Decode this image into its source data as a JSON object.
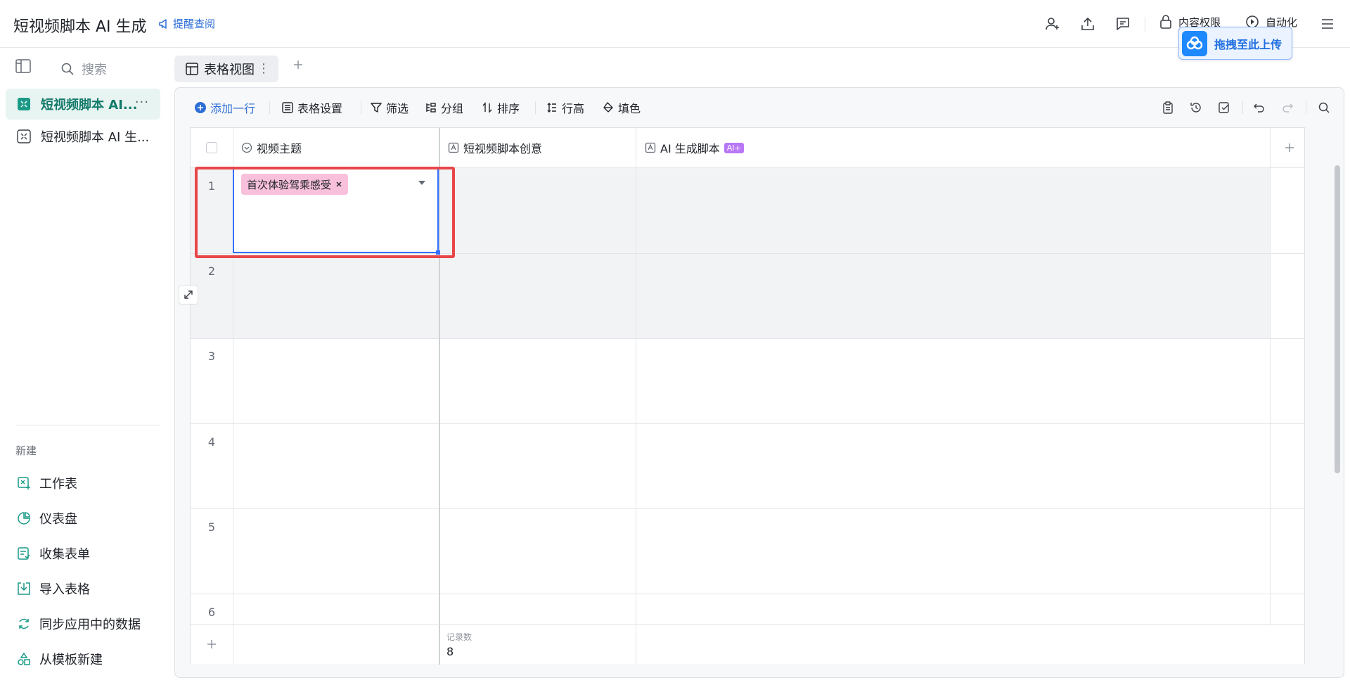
{
  "app": {
    "title": "短视频脚本 AI 生成",
    "remind_label": "提醒查阅"
  },
  "topbar": {
    "permission_label": "内容权限",
    "automation_label": "自动化"
  },
  "upload_float": {
    "label": "拖拽至此上传"
  },
  "sidebar": {
    "search_placeholder": "搜索",
    "items": [
      {
        "label": "短视频脚本 AI...",
        "more": "···"
      },
      {
        "label": "短视频脚本 AI 生..."
      }
    ],
    "new_label": "新建",
    "new_items": [
      {
        "label": "工作表"
      },
      {
        "label": "仪表盘"
      },
      {
        "label": "收集表单"
      },
      {
        "label": "导入表格"
      },
      {
        "label": "同步应用中的数据"
      },
      {
        "label": "从模板新建"
      }
    ]
  },
  "view_tab": {
    "label": "表格视图",
    "dots": "⋮"
  },
  "toolbar": {
    "add_row": "添加一行",
    "table_settings": "表格设置",
    "filter": "筛选",
    "group": "分组",
    "sort": "排序",
    "row_height": "行高",
    "fill": "填色"
  },
  "grid": {
    "columns": [
      {
        "label": "视频主题"
      },
      {
        "label": "短视频脚本创意"
      },
      {
        "label": "AI 生成脚本",
        "badge": "AI+"
      }
    ],
    "rows": [
      "1",
      "2",
      "3",
      "4",
      "5",
      "6"
    ],
    "editing_tag": "首次体验驾乘感受",
    "footer": {
      "label": "记录数",
      "value": "8"
    }
  },
  "colors": {
    "accent": "#3370ff",
    "tag": "#f8c0db",
    "highlight_box": "#e8474a",
    "active_sidebar": "#137a6a"
  }
}
